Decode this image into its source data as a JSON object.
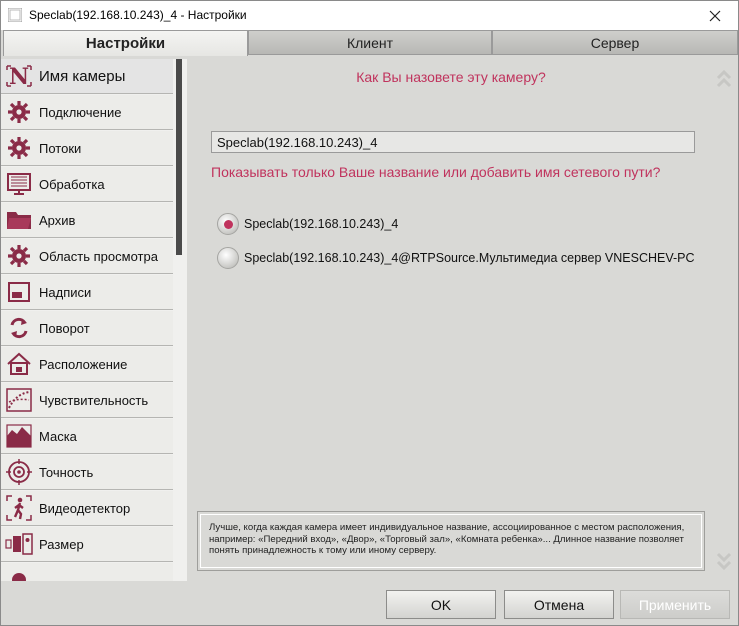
{
  "window": {
    "title": "Speclab(192.168.10.243)_4 - Настройки"
  },
  "tabs": [
    {
      "label": "Настройки"
    },
    {
      "label": "Клиент"
    },
    {
      "label": "Сервер"
    }
  ],
  "sidebar": {
    "items": [
      {
        "label": "Имя камеры",
        "icon": "camera-name-icon"
      },
      {
        "label": "Подключение",
        "icon": "gear-icon"
      },
      {
        "label": "Потоки",
        "icon": "gear-icon"
      },
      {
        "label": "Обработка",
        "icon": "monitor-icon"
      },
      {
        "label": "Архив",
        "icon": "folder-icon"
      },
      {
        "label": "Область просмотра",
        "icon": "gear-icon"
      },
      {
        "label": "Надписи",
        "icon": "window-icon"
      },
      {
        "label": "Поворот",
        "icon": "rotate-icon"
      },
      {
        "label": "Расположение",
        "icon": "house-icon"
      },
      {
        "label": "Чувствительность",
        "icon": "sensitivity-icon"
      },
      {
        "label": "Маска",
        "icon": "mask-icon"
      },
      {
        "label": "Точность",
        "icon": "target-icon"
      },
      {
        "label": "Видеодетектор",
        "icon": "walker-icon"
      },
      {
        "label": "Размер",
        "icon": "size-icon"
      }
    ]
  },
  "content": {
    "question": "Как Вы назовете эту камеру?",
    "name_value": "Speclab(192.168.10.243)_4",
    "subquestion": "Показывать только Ваше название или добавить имя сетевого пути?",
    "options": [
      {
        "label": "Speclab(192.168.10.243)_4",
        "selected": true
      },
      {
        "label": "Speclab(192.168.10.243)_4@RTPSource.Мультимедиа сервер VNESCHEV-PC",
        "selected": false
      }
    ],
    "hint": "Лучше, когда каждая камера имеет индивидуальное название, ассоциированное с местом расположения, например: «Передний вход», «Двор», «Торговый зал», «Комната ребенка»... Длинное название позволяет понять принадлежность к тому или иному серверу."
  },
  "buttons": {
    "ok": "OK",
    "cancel": "Отмена",
    "apply": "Применить"
  },
  "colors": {
    "accent": "#c0335d",
    "background": "#d9d9d6"
  }
}
